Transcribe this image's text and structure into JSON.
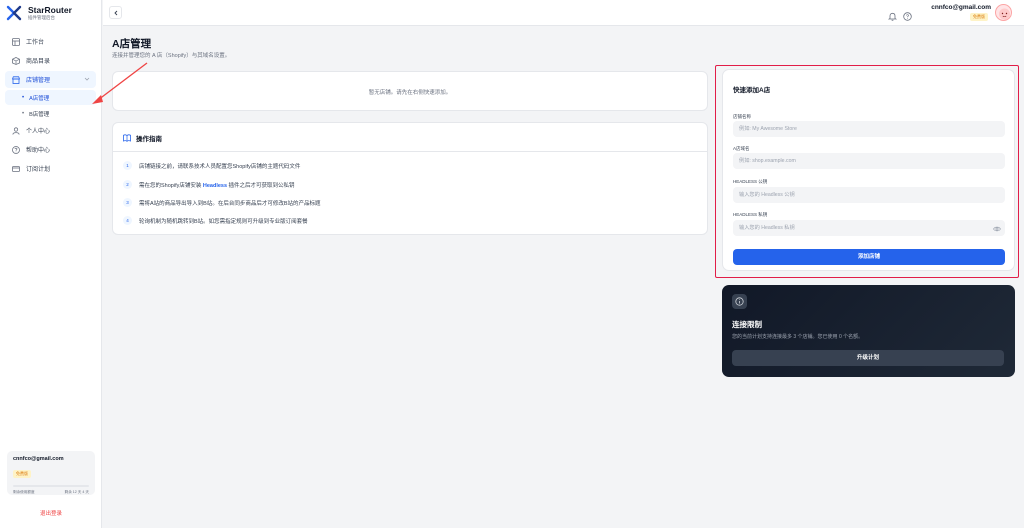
{
  "brand": {
    "name": "StarRouter",
    "sub": "插件管理后台"
  },
  "sidebar": {
    "items": [
      {
        "label": "工作台",
        "icon": "dashboard-icon"
      },
      {
        "label": "商品目录",
        "icon": "box-icon"
      },
      {
        "label": "店铺管理",
        "icon": "store-icon",
        "expanded": true
      },
      {
        "label": "个人中心",
        "icon": "user-icon"
      },
      {
        "label": "帮助中心",
        "icon": "help-icon"
      },
      {
        "label": "订阅计划",
        "icon": "card-icon"
      }
    ],
    "subitems": [
      {
        "label": "A店管理",
        "active": true
      },
      {
        "label": "B店管理",
        "active": false
      }
    ],
    "user": {
      "email": "cnnfco@gmail.com",
      "badge": "免费版",
      "usage_left": "剩余使用额度",
      "usage_right": "剩余 12 天 4 天"
    },
    "logout": "退出登录"
  },
  "topbar": {
    "email": "cnnfco@gmail.com",
    "badge": "免费版"
  },
  "main": {
    "title": "A店管理",
    "subtitle": "连接并管理您的 A 店（Shopify）与其域名设置。",
    "empty_text": "暂无店铺。请先在右侧快速添加。",
    "guide": {
      "title": "操作指南",
      "steps": [
        {
          "num": "1",
          "text": "店铺链接之前，请联系技术人员配置您Shopify店铺的主题代码文件"
        },
        {
          "num": "2",
          "pre": "需在您的Shopify店铺安装 ",
          "highlight": "Headless",
          "post": " 插件之后才可获取到公私钥"
        },
        {
          "num": "3",
          "text": "需将A站的商品导出导入到B站。在后台同步商品后才可修改B站的产品标题"
        },
        {
          "num": "4",
          "text": "轮询机制为随机跳转到B站。如您需指定规则可升级到专业版订阅套餐"
        }
      ]
    }
  },
  "quick_add": {
    "title": "快速添加A店",
    "fields": [
      {
        "label": "店铺名称",
        "placeholder": "例如: My Awesome Store"
      },
      {
        "label": "A店域名",
        "placeholder": "例如: shop.example.com"
      },
      {
        "label": "HEADLESS 公钥",
        "placeholder": "输入您的 Headless 公钥"
      },
      {
        "label": "HEADLESS 私钥",
        "placeholder": "输入您的 Headless 私钥"
      }
    ],
    "submit": "添加店铺"
  },
  "limit": {
    "title": "连接限制",
    "desc": "您的当前计划支持连接最多 3 个店铺。您已使用 0 个名额。",
    "button": "升级计划"
  },
  "colors": {
    "accent": "#2563eb",
    "danger": "#e11d48",
    "dark_card": "#111827"
  }
}
